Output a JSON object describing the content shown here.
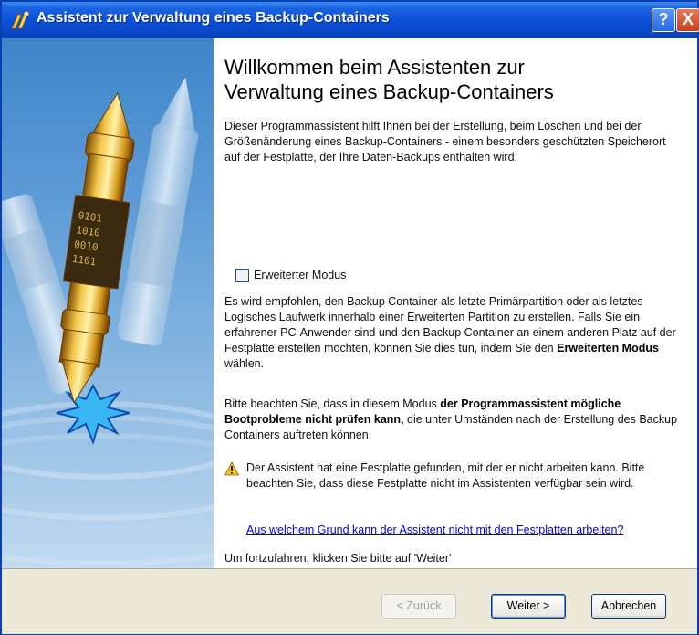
{
  "window": {
    "title": "Assistent zur Verwaltung eines Backup-Containers"
  },
  "titlebar_buttons": {
    "help": "?",
    "close": "X"
  },
  "content": {
    "heading_line1": "Willkommen beim Assistenten zur",
    "heading_line2": "Verwaltung eines Backup-Containers",
    "intro": "Dieser Programmassistent hilft Ihnen bei der Erstellung, beim Löschen und bei der Größenänderung eines Backup-Containers - einem besonders geschützten Speicherort auf der Festplatte, der Ihre Daten-Backups enthalten wird.",
    "advanced_mode": {
      "label": "Erweiterter Modus",
      "checked": false
    },
    "recommend_text": "Es wird empfohlen, den Backup Container als letzte Primärpartition oder als letztes Logisches Laufwerk innerhalb einer Erweiterten Partition zu erstellen. Falls Sie ein erfahrener PC-Anwender sind und den Backup Container an einem anderen Platz auf der Festplatte erstellen möchten, können Sie dies tun, indem Sie den",
    "recommend_bold": "Erweiterten Modus",
    "recommend_end": "wählen.",
    "note_start": "Bitte beachten Sie, dass in diesem Modus",
    "note_bold": "der Programmassistent mögliche Bootprobleme nicht prüfen kann,",
    "note_end": "die unter Umständen nach der Erstellung des Backup Containers auftreten können.",
    "warning": "Der Assistent hat eine Festplatte gefunden, mit der er nicht arbeiten kann. Bitte beachten Sie, dass diese Festplatte nicht im Assistenten verfügbar sein wird.",
    "help_link": "Aus welchem Grund kann der Assistent nicht mit den Festplatten arbeiten?",
    "footer": "Um fortzufahren, klicken Sie bitte auf 'Weiter'"
  },
  "buttons": {
    "back": "< Zurück",
    "next": "Weiter >",
    "cancel": "Abbrechen"
  },
  "icons": {
    "app": "backup-wizard-icon",
    "sidebar": "backup-container-illustration",
    "warning": "warning-icon"
  },
  "colors": {
    "titlebar": "#0b50d8",
    "link": "#0000ee",
    "close": "#c4401a",
    "bottom_bar": "#ece9d8"
  }
}
